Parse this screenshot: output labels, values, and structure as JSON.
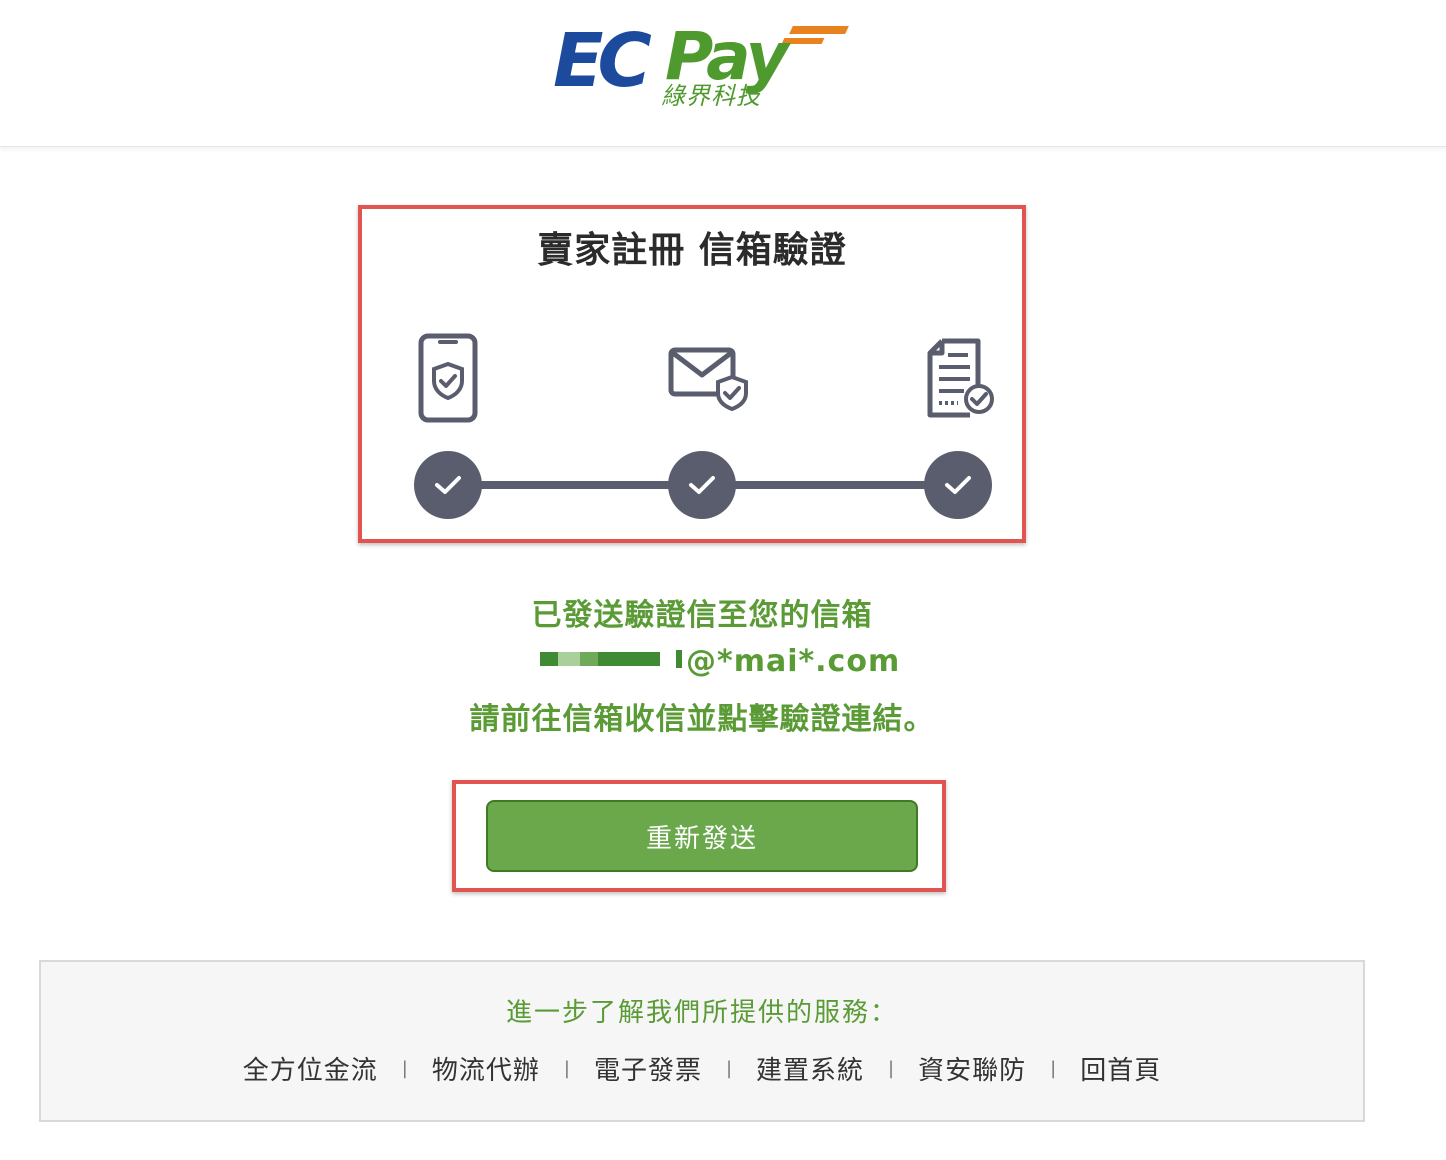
{
  "brand": {
    "logo_ec": "EC",
    "logo_pay": "Pay",
    "logo_sub": "綠界科技",
    "colors": {
      "blue": "#1c4a9c",
      "green": "#4f9a2e",
      "orange": "#e8821e"
    }
  },
  "steps": {
    "title": "賣家註冊  信箱驗證",
    "items": [
      {
        "icon": "phone-shield-icon",
        "status": "completed"
      },
      {
        "icon": "email-shield-icon",
        "status": "completed"
      },
      {
        "icon": "document-check-icon",
        "status": "completed"
      }
    ]
  },
  "message": {
    "line1": "已發送驗證信至您的信箱",
    "email": "@*mai*.com",
    "line3": "請前往信箱收信並點擊驗證連結。"
  },
  "resend_button": "重新發送",
  "footer": {
    "title": "進一步了解我們所提供的服務：",
    "links": [
      "全方位金流",
      "物流代辦",
      "電子發票",
      "建置系統",
      "資安聯防",
      "回首頁"
    ],
    "separator": "|"
  },
  "colors": {
    "accent_green": "#6aa84b",
    "text_green": "#5a9b36",
    "step_gray": "#595d6d",
    "highlight_red": "#e2544f"
  }
}
